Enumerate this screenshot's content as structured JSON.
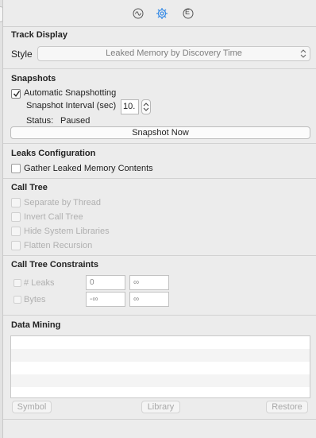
{
  "inspector": {
    "tabs": [
      {
        "icon": "waveform-icon"
      },
      {
        "icon": "gear-icon",
        "active": true
      },
      {
        "icon": "extended-detail-icon",
        "glyph": "E"
      }
    ]
  },
  "track_display": {
    "title": "Track Display",
    "style_label": "Style",
    "style_value": "Leaked Memory by Discovery Time"
  },
  "snapshots": {
    "title": "Snapshots",
    "auto_label": "Automatic Snapshotting",
    "auto_checked": true,
    "interval_label": "Snapshot Interval (sec)",
    "interval_value": "10.",
    "status_label": "Status:",
    "status_value": "Paused",
    "snapshot_now": "Snapshot Now"
  },
  "leaks_config": {
    "title": "Leaks Configuration",
    "gather_label": "Gather Leaked Memory Contents"
  },
  "call_tree": {
    "title": "Call Tree",
    "options": [
      "Separate by Thread",
      "Invert Call Tree",
      "Hide System Libraries",
      "Flatten Recursion"
    ]
  },
  "constraints": {
    "title": "Call Tree Constraints",
    "rows": [
      {
        "label": "# Leaks",
        "min": "0",
        "max": "∞"
      },
      {
        "label": "Bytes",
        "min": "-∞",
        "max": "∞"
      }
    ]
  },
  "data_mining": {
    "title": "Data Mining",
    "buttons": {
      "symbol": "Symbol",
      "library": "Library",
      "restore": "Restore"
    }
  },
  "colors": {
    "accent": "#3d8ee6",
    "separator": "#d2d2d2",
    "background": "#ececec"
  }
}
